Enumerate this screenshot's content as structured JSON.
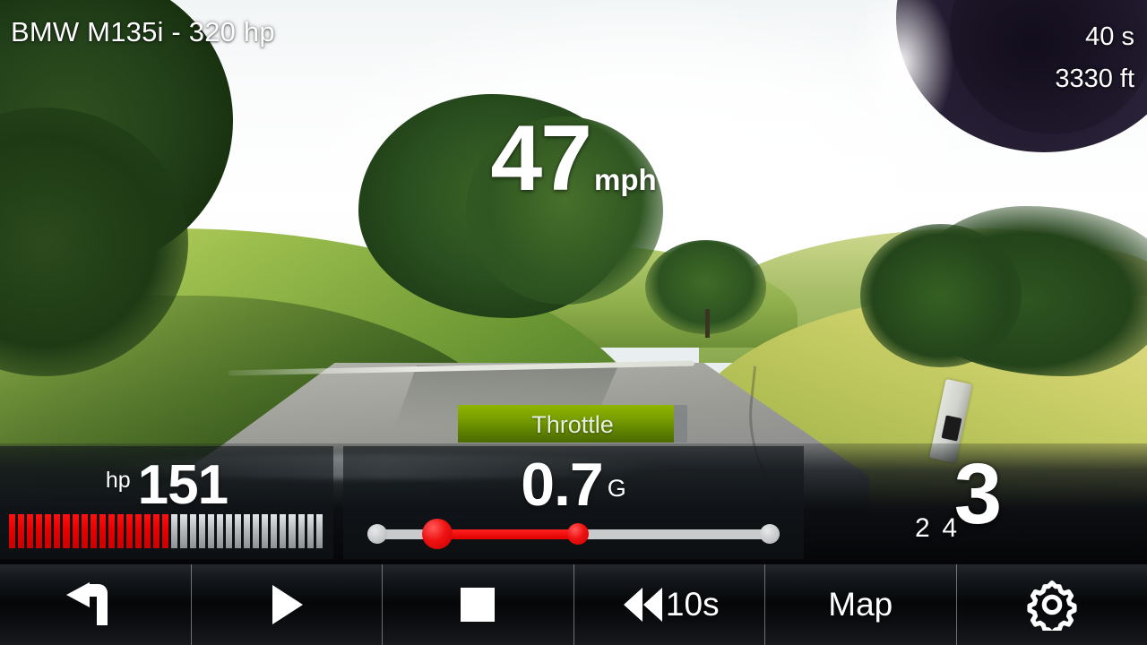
{
  "header": {
    "title": "BMW M135i - 320 hp",
    "session_time": "40 s",
    "distance": "3330 ft"
  },
  "speed": {
    "value": "47",
    "unit": "mph"
  },
  "throttle": {
    "label": "Throttle",
    "fill_percent": 94,
    "color": "#79a000"
  },
  "power": {
    "unit": "hp",
    "value": "151",
    "segments_total": 35,
    "segments_on": 18,
    "on_color": "#e80000",
    "off_color": "#b8bbbe"
  },
  "gforce": {
    "value": "0.7",
    "unit": "G",
    "slider": {
      "marker_percent": 17,
      "peak_percent": 51,
      "fill_color": "#e00000",
      "track_color": "#c9cacb"
    }
  },
  "gear": {
    "current": "3",
    "previous": "2",
    "next": "4"
  },
  "toolbar": {
    "items": [
      {
        "name": "back",
        "icon": "back-arrow-icon",
        "label": ""
      },
      {
        "name": "play",
        "icon": "play-icon",
        "label": ""
      },
      {
        "name": "stop",
        "icon": "stop-icon",
        "label": ""
      },
      {
        "name": "rewind",
        "icon": "rewind-icon",
        "label": "10s"
      },
      {
        "name": "map",
        "icon": "",
        "label": "Map"
      },
      {
        "name": "settings",
        "icon": "gear-icon",
        "label": ""
      }
    ]
  }
}
